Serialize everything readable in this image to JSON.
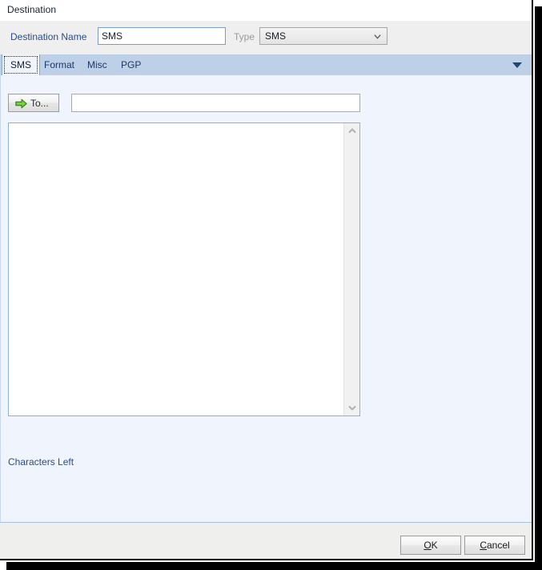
{
  "window": {
    "title": "Destination"
  },
  "header": {
    "destination_name_label": "Destination Name",
    "destination_name_value": "SMS",
    "type_label": "Type",
    "type_value": "SMS",
    "type_chevron_icon": "chevron-down-icon"
  },
  "tabs": {
    "items": [
      {
        "label": "SMS",
        "active": true
      },
      {
        "label": "Format",
        "active": false
      },
      {
        "label": "Misc",
        "active": false
      },
      {
        "label": "PGP",
        "active": false
      }
    ],
    "overflow_icon": "triangle-down-icon"
  },
  "main": {
    "to_button_label": "To...",
    "to_button_icon": "green-arrow-right-icon",
    "recipient_value": "",
    "recipient_placeholder": "",
    "message_value": "",
    "message_placeholder": "",
    "scroll_up_icon": "chevron-up-icon",
    "scroll_down_icon": "chevron-down-icon",
    "characters_left_label": "Characters Left"
  },
  "footer": {
    "ok_accel": "O",
    "ok_rest": "K",
    "cancel_accel": "C",
    "cancel_lead": "",
    "cancel_rest": "ancel"
  },
  "colors": {
    "panel_background": "#eff4fd",
    "tabstrip_background": "#bed0e8",
    "header_background": "#efefef",
    "title_background": "#ffffff",
    "footer_background": "#efefee",
    "label_blue": "#2a4b8d",
    "disabled_gray": "#9a9a9a",
    "accent_green": "#5db531",
    "field_border": "#8fb0d1"
  }
}
